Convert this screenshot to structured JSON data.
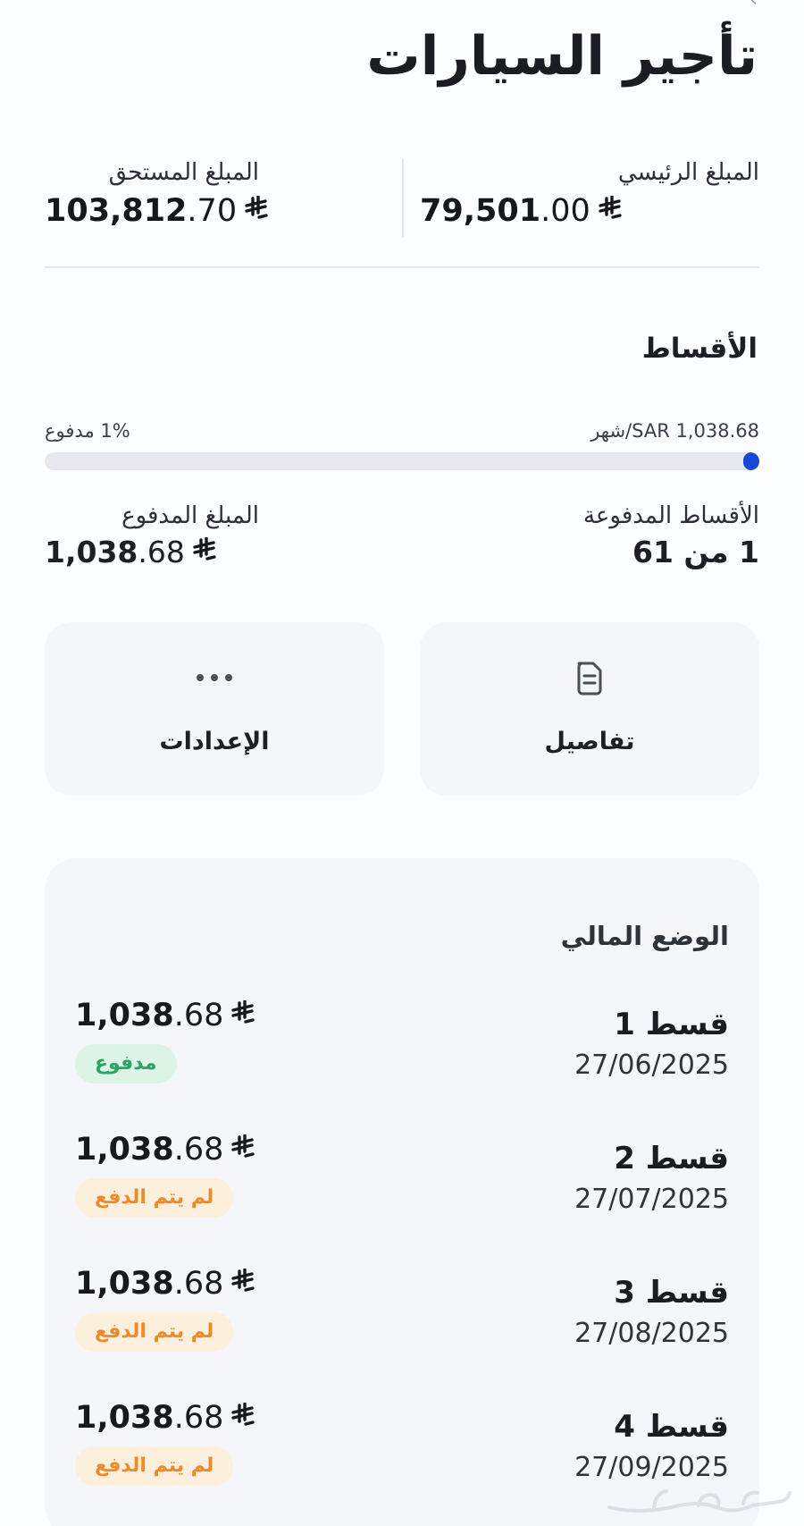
{
  "header": {
    "title": "تأجير السيارات"
  },
  "summary": {
    "principal_label": "المبلغ الرئيسي",
    "principal_int": "79,501",
    "principal_dec": ".00",
    "due_label": "المبلغ المستحق",
    "due_int": "103,812",
    "due_dec": ".70"
  },
  "installments": {
    "title": "الأقساط",
    "monthly_text": "SAR 1,038.68/شهر",
    "paid_percent_text": "1% مدفوع",
    "progress_fraction": 0.01,
    "paid_installments_label": "الأقساط المدفوعة",
    "paid_installments_value": "1 من 61",
    "paid_amount_label": "المبلغ المدفوع",
    "paid_amount_int": "1,038",
    "paid_amount_dec": ".68"
  },
  "actions": {
    "details_label": "تفاصيل",
    "details_icon": "document-icon",
    "settings_label": "الإعدادات",
    "settings_icon": "more-dots-icon"
  },
  "financial_status": {
    "title": "الوضع المالي",
    "rows": [
      {
        "name": "قسط 1",
        "date": "27/06/2025",
        "amount_int": "1,038",
        "amount_dec": ".68",
        "status": "مدفوع",
        "status_type": "paid"
      },
      {
        "name": "قسط 2",
        "date": "27/07/2025",
        "amount_int": "1,038",
        "amount_dec": ".68",
        "status": "لم يتم الدفع",
        "status_type": "unpaid"
      },
      {
        "name": "قسط 3",
        "date": "27/08/2025",
        "amount_int": "1,038",
        "amount_dec": ".68",
        "status": "لم يتم الدفع",
        "status_type": "unpaid"
      },
      {
        "name": "قسط 4",
        "date": "27/09/2025",
        "amount_int": "1,038",
        "amount_dec": ".68",
        "status": "لم يتم الدفع",
        "status_type": "unpaid"
      }
    ]
  },
  "colors": {
    "accent": "#1747d6",
    "paid_bg": "#dcf4e6",
    "paid_fg": "#2aa466",
    "unpaid_bg": "#fcefdc",
    "unpaid_fg": "#f0892a"
  },
  "watermark": {
    "text": "حراج"
  }
}
